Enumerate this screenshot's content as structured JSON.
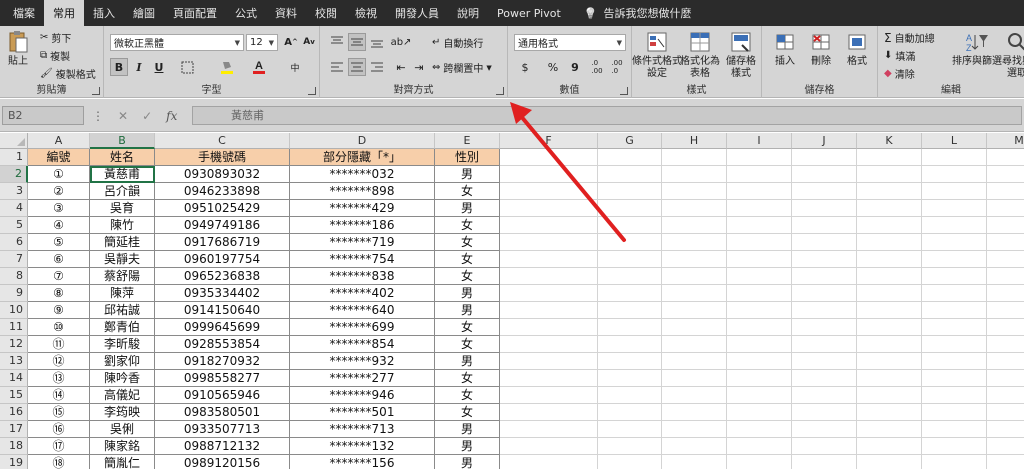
{
  "tabs": [
    {
      "label": "檔案",
      "active": false
    },
    {
      "label": "常用",
      "active": true
    },
    {
      "label": "插入",
      "active": false
    },
    {
      "label": "繪圖",
      "active": false
    },
    {
      "label": "頁面配置",
      "active": false
    },
    {
      "label": "公式",
      "active": false
    },
    {
      "label": "資料",
      "active": false
    },
    {
      "label": "校閱",
      "active": false
    },
    {
      "label": "檢視",
      "active": false
    },
    {
      "label": "開發人員",
      "active": false
    },
    {
      "label": "說明",
      "active": false
    },
    {
      "label": "Power Pivot",
      "active": false
    }
  ],
  "tellme": "告訴我您想做什麼",
  "ribbon": {
    "clipboard": {
      "paste": "貼上",
      "cut": "剪下",
      "copy": "複製",
      "format_painter": "複製格式",
      "label": "剪貼簿"
    },
    "font": {
      "name": "微軟正黑體",
      "size": "12",
      "bold": "B",
      "italic": "I",
      "underline": "U",
      "label": "字型"
    },
    "alignment": {
      "wrap": "自動換行",
      "merge": "跨欄置中",
      "label": "對齊方式"
    },
    "number": {
      "format": "通用格式",
      "currency": "$",
      "percent": "%",
      "comma": "9",
      "label": "數值"
    },
    "styles": {
      "conditional": "條件式格式\n設定",
      "as_table": "格式化為\n表格",
      "cell_styles": "儲存格\n樣式",
      "label": "樣式"
    },
    "cells": {
      "insert": "插入",
      "delete": "刪除",
      "format": "格式",
      "label": "儲存格"
    },
    "editing": {
      "autosum": "自動加總",
      "fill": "填滿",
      "clear": "清除",
      "sort": "排序與篩選",
      "find": "尋找與\n選取",
      "label": "編輯"
    }
  },
  "formula_bar": {
    "name_box": "B2",
    "cancel": "✕",
    "enter": "✓",
    "fx": "fx",
    "value": "黃慈甫"
  },
  "columns": [
    "A",
    "B",
    "C",
    "D",
    "E",
    "F",
    "G",
    "H",
    "I",
    "J",
    "K",
    "L",
    "M"
  ],
  "selected_cell": "B2",
  "headers": [
    "編號",
    "姓名",
    "手機號碼",
    "部分隱藏「*」",
    "性別"
  ],
  "rows": [
    [
      "①",
      "黃慈甫",
      "0930893032",
      "*******032",
      "男"
    ],
    [
      "②",
      "呂介韻",
      "0946233898",
      "*******898",
      "女"
    ],
    [
      "③",
      "吳育",
      "0951025429",
      "*******429",
      "男"
    ],
    [
      "④",
      "陳竹",
      "0949749186",
      "*******186",
      "女"
    ],
    [
      "⑤",
      "簡延桂",
      "0917686719",
      "*******719",
      "女"
    ],
    [
      "⑥",
      "吳靜夫",
      "0960197754",
      "*******754",
      "女"
    ],
    [
      "⑦",
      "蔡舒陽",
      "0965236838",
      "*******838",
      "女"
    ],
    [
      "⑧",
      "陳萍",
      "0935334402",
      "*******402",
      "男"
    ],
    [
      "⑨",
      "邱祐誠",
      "0914150640",
      "*******640",
      "男"
    ],
    [
      "⑩",
      "鄭青伯",
      "0999645699",
      "*******699",
      "女"
    ],
    [
      "⑪",
      "李昕駿",
      "0928553854",
      "*******854",
      "女"
    ],
    [
      "⑫",
      "劉家仰",
      "0918270932",
      "*******932",
      "男"
    ],
    [
      "⑬",
      "陳吟香",
      "0998558277",
      "*******277",
      "女"
    ],
    [
      "⑭",
      "高儀妃",
      "0910565946",
      "*******946",
      "女"
    ],
    [
      "⑮",
      "李筠映",
      "0983580501",
      "*******501",
      "女"
    ],
    [
      "⑯",
      "吳俐",
      "0933507713",
      "*******713",
      "男"
    ],
    [
      "⑰",
      "陳家銘",
      "0988712132",
      "*******132",
      "男"
    ],
    [
      "⑱",
      "簡胤仁",
      "0989120156",
      "*******156",
      "男"
    ]
  ],
  "colors": {
    "header_fill": "#f7cfaa",
    "accent": "#217346",
    "annotation": "#e02020"
  }
}
